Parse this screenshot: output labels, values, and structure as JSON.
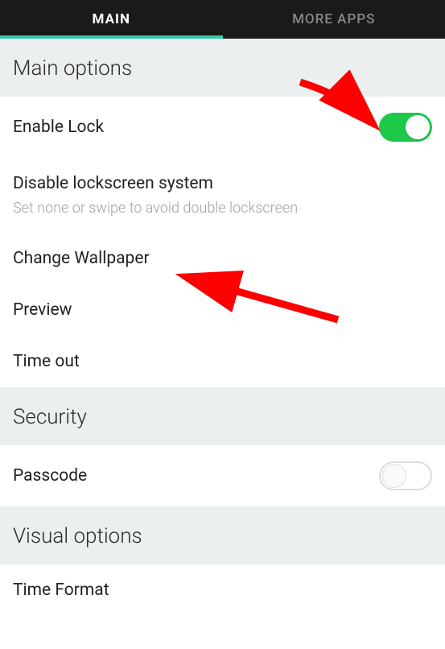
{
  "tabs": {
    "main": "MAIN",
    "more_apps": "MORE APPS",
    "active": "main"
  },
  "sections": {
    "main_options": {
      "header": "Main options",
      "enable_lock": {
        "label": "Enable Lock",
        "on": true
      },
      "disable_lockscreen": {
        "label": "Disable lockscreen system",
        "sub": "Set none or swipe to avoid double lockscreen"
      },
      "change_wallpaper": {
        "label": "Change Wallpaper"
      },
      "preview": {
        "label": "Preview"
      },
      "time_out": {
        "label": "Time out"
      }
    },
    "security": {
      "header": "Security",
      "passcode": {
        "label": "Passcode",
        "on": false
      }
    },
    "visual": {
      "header": "Visual options",
      "time_format": {
        "label": "Time Format"
      }
    }
  },
  "annotations": {
    "arrow1_target": "enable-lock-toggle",
    "arrow2_target": "change-wallpaper-row",
    "arrow_color": "#ff0000"
  }
}
